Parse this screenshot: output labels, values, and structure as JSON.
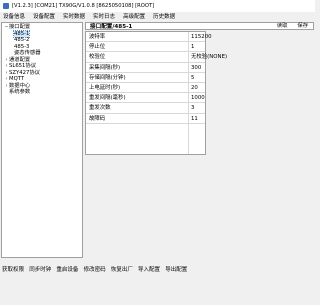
{
  "window": {
    "title": "[V1.2.3] [COM21] TX90G/V1.0.8 [8625050108] [ROOT]"
  },
  "menu": {
    "items": [
      "设备信息",
      "设备配置",
      "实时数据",
      "实时日志",
      "高级配置",
      "历史数据"
    ]
  },
  "tree": {
    "items": [
      {
        "label": "接口配置",
        "toggle": "−",
        "level": 0
      },
      {
        "label": "485-1",
        "toggle": "",
        "level": 1,
        "selected": true
      },
      {
        "label": "485-2",
        "toggle": "",
        "level": 1
      },
      {
        "label": "485-3",
        "toggle": "",
        "level": 1
      },
      {
        "label": "姿态传感器",
        "toggle": "",
        "level": 1
      },
      {
        "label": "通道配置",
        "toggle": "›",
        "level": 0
      },
      {
        "label": "SL651协议",
        "toggle": "›",
        "level": 0
      },
      {
        "label": "SZY427协议",
        "toggle": "›",
        "level": 0
      },
      {
        "label": "MQTT",
        "toggle": "›",
        "level": 0
      },
      {
        "label": "数据中心",
        "toggle": "›",
        "level": 0
      },
      {
        "label": "系统参数",
        "toggle": "",
        "level": 0
      }
    ]
  },
  "panel": {
    "title": "接口配置/485-1",
    "read_label": "读取",
    "save_label": "保存",
    "rows": [
      {
        "label": "波特率",
        "value": "115200"
      },
      {
        "label": "停止位",
        "value": "1"
      },
      {
        "label": "校验位",
        "value": "无校验(NONE)"
      },
      {
        "label": "采集间隔(秒)",
        "value": "300"
      },
      {
        "label": "存储间隔(分钟)",
        "value": "5"
      },
      {
        "label": "上电延时(秒)",
        "value": "20"
      },
      {
        "label": "重发间隔(毫秒)",
        "value": "1000"
      },
      {
        "label": "重发次数",
        "value": "3"
      },
      {
        "label": "故障码",
        "value": "11"
      }
    ]
  },
  "toolbar": {
    "buttons": [
      "获取权限",
      "同步时钟",
      "重启设备",
      "修改密码",
      "恢复出厂",
      "导入配置",
      "导出配置"
    ]
  }
}
